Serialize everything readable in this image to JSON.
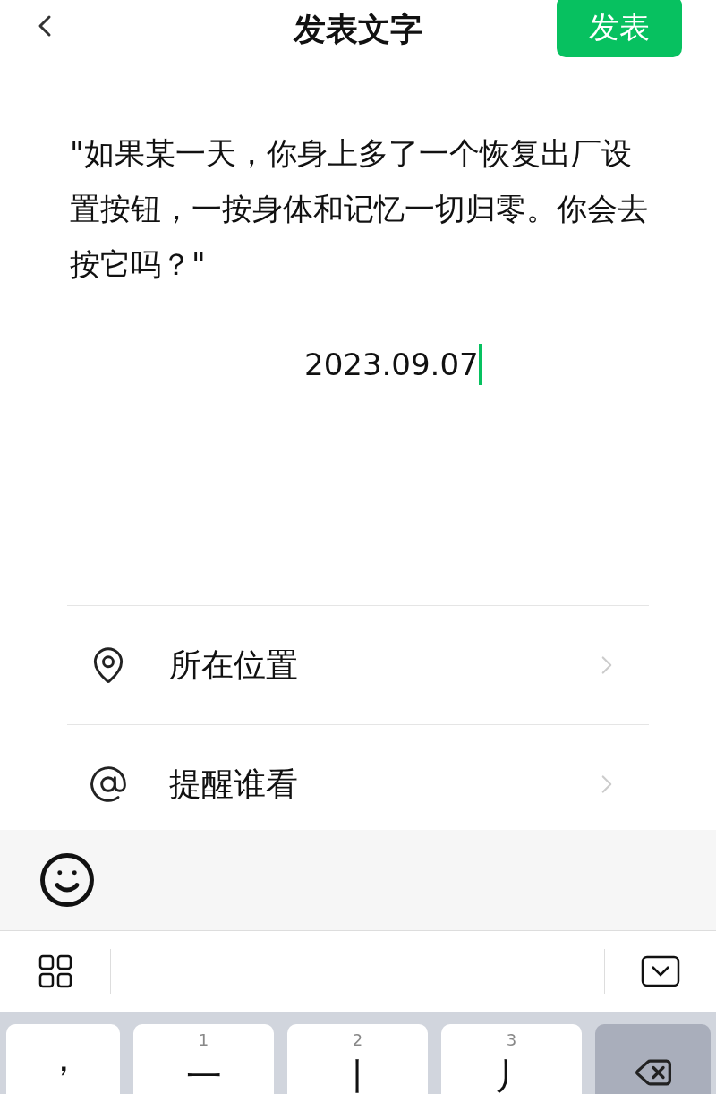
{
  "header": {
    "title": "发表文字",
    "publish_button": "发表"
  },
  "post": {
    "text": "\"如果某一天，你身上多了一个恢复出厂设置按钮，一按身体和记忆一切归零。你会去按它吗？\"",
    "date_line": "2023.09.07"
  },
  "options": [
    {
      "kind": "location",
      "label": "所在位置"
    },
    {
      "kind": "mention",
      "label": "提醒谁看"
    }
  ],
  "keyboard": {
    "keys": [
      {
        "kind": "char",
        "label": "，"
      },
      {
        "kind": "stroke",
        "number": "1",
        "label": "一"
      },
      {
        "kind": "stroke",
        "number": "2",
        "label": "丨"
      },
      {
        "kind": "stroke",
        "number": "3",
        "label": "丿"
      },
      {
        "kind": "backspace"
      }
    ]
  }
}
